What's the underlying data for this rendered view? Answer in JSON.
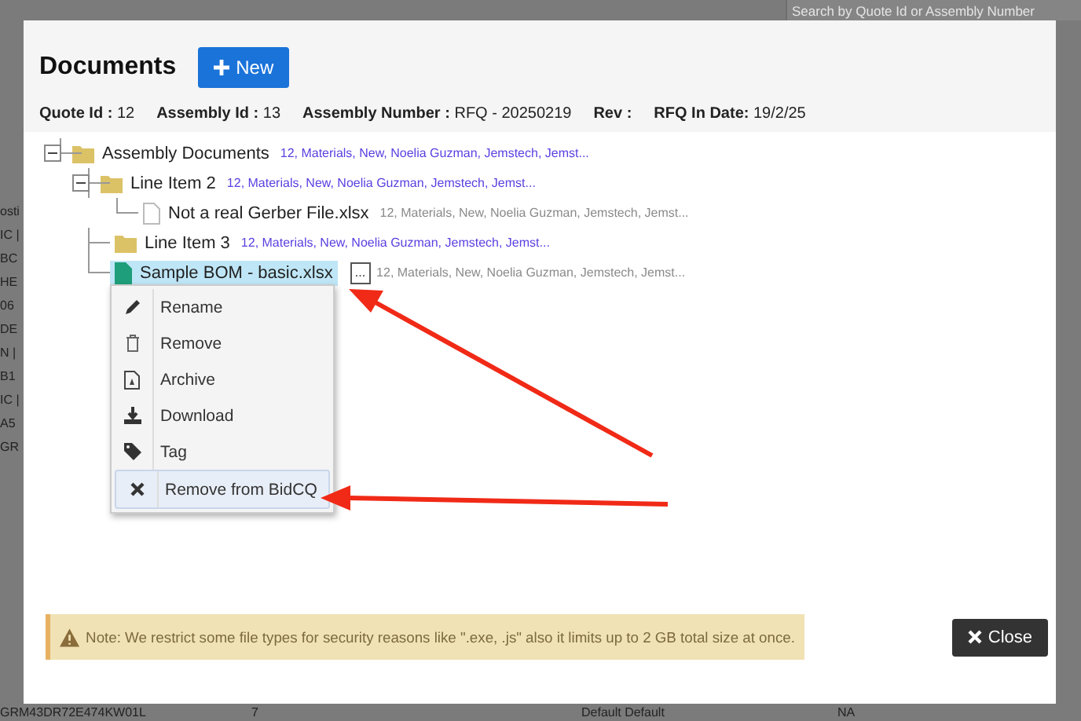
{
  "background": {
    "search": {
      "placeholder": "Search by Quote Id or Assembly Number"
    },
    "fragments": [
      "osti",
      "IC |",
      "BC",
      "HE",
      "06",
      "DE",
      "N |",
      "B1",
      "IC |",
      "A5",
      "GR"
    ],
    "bottom_row": [
      "GRM43DR72E474KW01L",
      "7",
      "Default Default",
      "NA"
    ]
  },
  "dialog": {
    "title": "Documents",
    "new_button": "New",
    "info": [
      {
        "label": "Quote Id :",
        "value": "12"
      },
      {
        "label": "Assembly Id :",
        "value": "13"
      },
      {
        "label": "Assembly Number :",
        "value": "RFQ - 20250219"
      },
      {
        "label": "Rev :"
      },
      {
        "label": "RFQ In Date:",
        "value": "19/2/25"
      }
    ],
    "tree": [
      {
        "kind": "folder",
        "name": "Assembly Documents",
        "meta": "12, Materials, New, Noelia Guzman, Jemstech, Jemst...",
        "expanded": true,
        "selected": false,
        "children": [
          {
            "kind": "folder",
            "name": "Line Item 2",
            "meta": "12, Materials, New, Noelia Guzman, Jemstech, Jemst...",
            "expanded": true,
            "selected": false,
            "children": [
              {
                "kind": "file",
                "name": "Not a real Gerber File.xlsx",
                "meta": "12, Materials, New, Noelia Guzman, Jemstech, Jemst...",
                "selected": false
              }
            ]
          },
          {
            "kind": "folder",
            "name": "Line Item 3",
            "meta": "12, Materials, New, Noelia Guzman, Jemstech, Jemst...",
            "selected": false
          },
          {
            "kind": "spreadsheet",
            "name": "Sample BOM - basic.xlsx",
            "meta": "12, Materials, New, Noelia Guzman, Jemstech, Jemst...",
            "selected": true,
            "more": "..."
          }
        ]
      }
    ],
    "context_menu": [
      {
        "label": "Rename",
        "selected": false
      },
      {
        "label": "Remove",
        "selected": false
      },
      {
        "label": "Archive",
        "selected": false
      },
      {
        "label": "Download",
        "selected": false
      },
      {
        "label": "Tag",
        "selected": false
      },
      {
        "label": "Remove from BidCQ",
        "selected": true
      }
    ],
    "note": "Note: We restrict some file types for security reasons like \".exe, .js\" also it limits up to 2 GB total size at once.",
    "close_button": "Close"
  }
}
